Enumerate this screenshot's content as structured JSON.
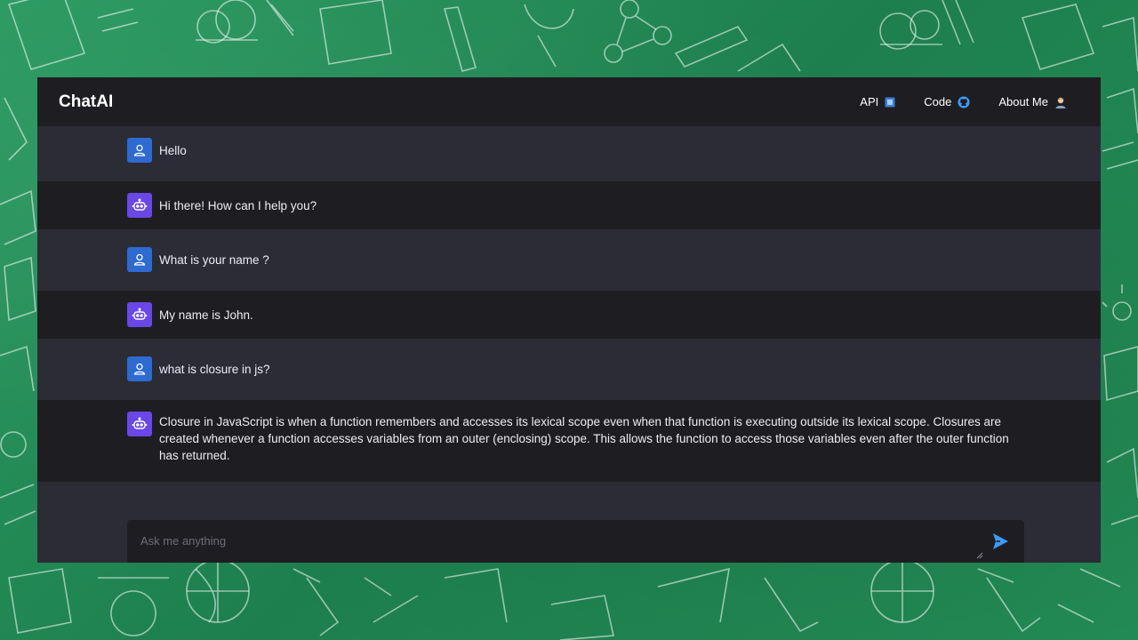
{
  "app": {
    "brand": "ChatAI"
  },
  "nav": {
    "items": [
      {
        "label": "API",
        "icon": "chip-icon"
      },
      {
        "label": "Code",
        "icon": "github-icon"
      },
      {
        "label": "About Me",
        "icon": "person-icon"
      }
    ]
  },
  "chat": {
    "messages": [
      {
        "role": "user",
        "text": "Hello"
      },
      {
        "role": "bot",
        "text": "Hi there! How can I help you?"
      },
      {
        "role": "user",
        "text": "What is your name ?"
      },
      {
        "role": "bot",
        "text": "My name is John."
      },
      {
        "role": "user",
        "text": "what is closure in js?"
      },
      {
        "role": "bot",
        "text": "Closure in JavaScript is when a function remembers and accesses its lexical scope even when that function is executing outside its lexical scope. Closures are created whenever a function accesses variables from an outer (enclosing) scope. This allows the function to access those variables even after the outer function has returned."
      }
    ]
  },
  "composer": {
    "placeholder": "Ask me anything",
    "value": ""
  },
  "colors": {
    "background": "#1f8a55",
    "navbar": "#1e1e22",
    "user_row": "#2c2c34",
    "bot_row": "#1e1e22",
    "user_avatar": "#2d6ad2",
    "bot_avatar": "#6a47e6",
    "send_accent": "#3b9cf5"
  }
}
